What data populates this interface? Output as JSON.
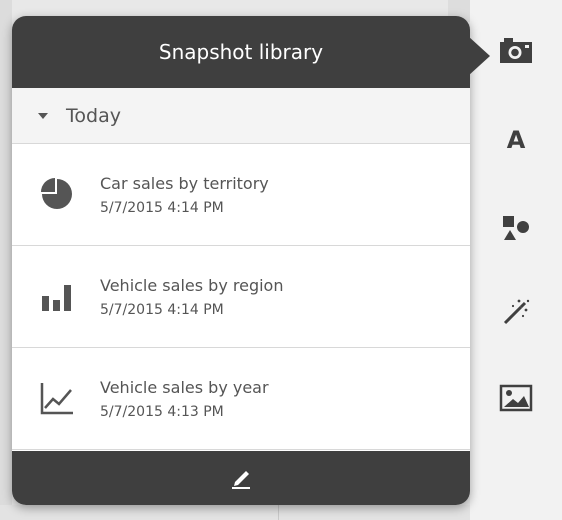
{
  "popover": {
    "title": "Snapshot library",
    "section": {
      "label": "Today",
      "expanded": true
    },
    "items": [
      {
        "title": "Car sales by territory",
        "date": "5/7/2015 4:14 PM",
        "icon": "pie-chart-icon"
      },
      {
        "title": "Vehicle sales by region",
        "date": "5/7/2015 4:14 PM",
        "icon": "bar-chart-icon"
      },
      {
        "title": "Vehicle sales by year",
        "date": "5/7/2015 4:13 PM",
        "icon": "line-chart-icon"
      }
    ],
    "footer": {
      "edit_icon": "pen-icon"
    }
  },
  "toolbar": {
    "tools": [
      {
        "icon": "camera-icon",
        "active": true
      },
      {
        "icon": "text-icon",
        "label": "A"
      },
      {
        "icon": "shapes-icon"
      },
      {
        "icon": "magic-wand-icon"
      },
      {
        "icon": "image-icon"
      }
    ]
  },
  "colors": {
    "header_bg": "#3f3f3f",
    "text": "#555555",
    "section_bg": "#f4f4f4",
    "toolbar_bg": "#f2f2f2"
  }
}
